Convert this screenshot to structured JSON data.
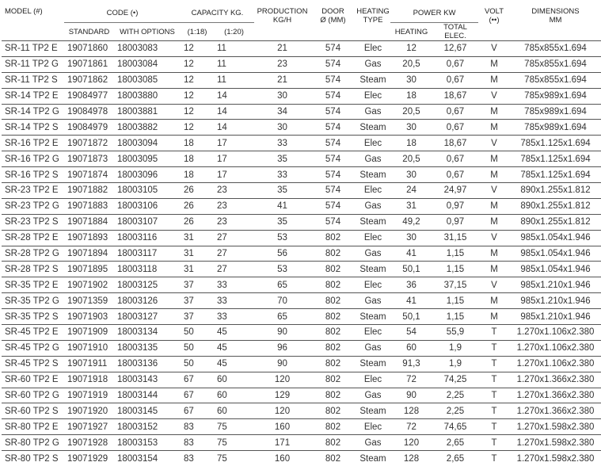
{
  "header": {
    "model": "MODEL (#)",
    "code": "CODE (•)",
    "standard": "STANDARD",
    "with_options": "WITH OPTIONS",
    "capacity": "CAPACITY KG.",
    "cap_118": "(1:18)",
    "cap_120": "(1:20)",
    "production_1": "PRODUCTION",
    "production_2": "KG/H",
    "door_1": "DOOR",
    "door_2": "Ø (MM)",
    "heating_1": "HEATING",
    "heating_2": "TYPE",
    "power": "POWER KW",
    "power_heating": "HEATING",
    "power_total": "TOTAL ELEC.",
    "volt_1": "VOLT",
    "volt_2": "(••)",
    "dim_1": "DIMENSIONS",
    "dim_2": "MM"
  },
  "rows": [
    [
      "SR-11 TP2 E",
      "19071860",
      "18003083",
      "12",
      "11",
      "21",
      "574",
      "Elec",
      "12",
      "12,67",
      "V",
      "785x855x1.694"
    ],
    [
      "SR-11 TP2 G",
      "19071861",
      "18003084",
      "12",
      "11",
      "23",
      "574",
      "Gas",
      "20,5",
      "0,67",
      "M",
      "785x855x1.694"
    ],
    [
      "SR-11 TP2 S",
      "19071862",
      "18003085",
      "12",
      "11",
      "21",
      "574",
      "Steam",
      "30",
      "0,67",
      "M",
      "785x855x1.694"
    ],
    [
      "SR-14 TP2 E",
      "19084977",
      "18003880",
      "12",
      "14",
      "30",
      "574",
      "Elec",
      "18",
      "18,67",
      "V",
      "785x989x1.694"
    ],
    [
      "SR-14 TP2 G",
      "19084978",
      "18003881",
      "12",
      "14",
      "34",
      "574",
      "Gas",
      "20,5",
      "0,67",
      "M",
      "785x989x1.694"
    ],
    [
      "SR-14 TP2 S",
      "19084979",
      "18003882",
      "12",
      "14",
      "30",
      "574",
      "Steam",
      "30",
      "0,67",
      "M",
      "785x989x1.694"
    ],
    [
      "SR-16 TP2 E",
      "19071872",
      "18003094",
      "18",
      "17",
      "33",
      "574",
      "Elec",
      "18",
      "18,67",
      "V",
      "785x1.125x1.694"
    ],
    [
      "SR-16 TP2 G",
      "19071873",
      "18003095",
      "18",
      "17",
      "35",
      "574",
      "Gas",
      "20,5",
      "0,67",
      "M",
      "785x1.125x1.694"
    ],
    [
      "SR-16 TP2 S",
      "19071874",
      "18003096",
      "18",
      "17",
      "33",
      "574",
      "Steam",
      "30",
      "0,67",
      "M",
      "785x1.125x1.694"
    ],
    [
      "SR-23 TP2 E",
      "19071882",
      "18003105",
      "26",
      "23",
      "35",
      "574",
      "Elec",
      "24",
      "24,97",
      "V",
      "890x1.255x1.812"
    ],
    [
      "SR-23 TP2 G",
      "19071883",
      "18003106",
      "26",
      "23",
      "41",
      "574",
      "Gas",
      "31",
      "0,97",
      "M",
      "890x1.255x1.812"
    ],
    [
      "SR-23 TP2 S",
      "19071884",
      "18003107",
      "26",
      "23",
      "35",
      "574",
      "Steam",
      "49,2",
      "0,97",
      "M",
      "890x1.255x1.812"
    ],
    [
      "SR-28 TP2 E",
      "19071893",
      "18003116",
      "31",
      "27",
      "53",
      "802",
      "Elec",
      "30",
      "31,15",
      "V",
      "985x1.054x1.946"
    ],
    [
      "SR-28 TP2 G",
      "19071894",
      "18003117",
      "31",
      "27",
      "56",
      "802",
      "Gas",
      "41",
      "1,15",
      "M",
      "985x1.054x1.946"
    ],
    [
      "SR-28 TP2 S",
      "19071895",
      "18003118",
      "31",
      "27",
      "53",
      "802",
      "Steam",
      "50,1",
      "1,15",
      "M",
      "985x1.054x1.946"
    ],
    [
      "SR-35 TP2 E",
      "19071902",
      "18003125",
      "37",
      "33",
      "65",
      "802",
      "Elec",
      "36",
      "37,15",
      "V",
      "985x1.210x1.946"
    ],
    [
      "SR-35 TP2 G",
      "19071359",
      "18003126",
      "37",
      "33",
      "70",
      "802",
      "Gas",
      "41",
      "1,15",
      "M",
      "985x1.210x1.946"
    ],
    [
      "SR-35 TP2 S",
      "19071903",
      "18003127",
      "37",
      "33",
      "65",
      "802",
      "Steam",
      "50,1",
      "1,15",
      "M",
      "985x1.210x1.946"
    ],
    [
      "SR-45 TP2 E",
      "19071909",
      "18003134",
      "50",
      "45",
      "90",
      "802",
      "Elec",
      "54",
      "55,9",
      "T",
      "1.270x1.106x2.380"
    ],
    [
      "SR-45 TP2 G",
      "19071910",
      "18003135",
      "50",
      "45",
      "96",
      "802",
      "Gas",
      "60",
      "1,9",
      "T",
      "1.270x1.106x2.380"
    ],
    [
      "SR-45 TP2 S",
      "19071911",
      "18003136",
      "50",
      "45",
      "90",
      "802",
      "Steam",
      "91,3",
      "1,9",
      "T",
      "1.270x1.106x2.380"
    ],
    [
      "SR-60 TP2 E",
      "19071918",
      "18003143",
      "67",
      "60",
      "120",
      "802",
      "Elec",
      "72",
      "74,25",
      "T",
      "1.270x1.366x2.380"
    ],
    [
      "SR-60 TP2 G",
      "19071919",
      "18003144",
      "67",
      "60",
      "129",
      "802",
      "Gas",
      "90",
      "2,25",
      "T",
      "1.270x1.366x2.380"
    ],
    [
      "SR-60 TP2 S",
      "19071920",
      "18003145",
      "67",
      "60",
      "120",
      "802",
      "Steam",
      "128",
      "2,25",
      "T",
      "1.270x1.366x2.380"
    ],
    [
      "SR-80 TP2 E",
      "19071927",
      "18003152",
      "83",
      "75",
      "160",
      "802",
      "Elec",
      "72",
      "74,65",
      "T",
      "1.270x1.598x2.380"
    ],
    [
      "SR-80 TP2 G",
      "19071928",
      "18003153",
      "83",
      "75",
      "171",
      "802",
      "Gas",
      "120",
      "2,65",
      "T",
      "1.270x1.598x2.380"
    ],
    [
      "SR-80 TP2 S",
      "19071929",
      "18003154",
      "83",
      "75",
      "160",
      "802",
      "Steam",
      "128",
      "2,65",
      "T",
      "1.270x1.598x2.380"
    ]
  ]
}
